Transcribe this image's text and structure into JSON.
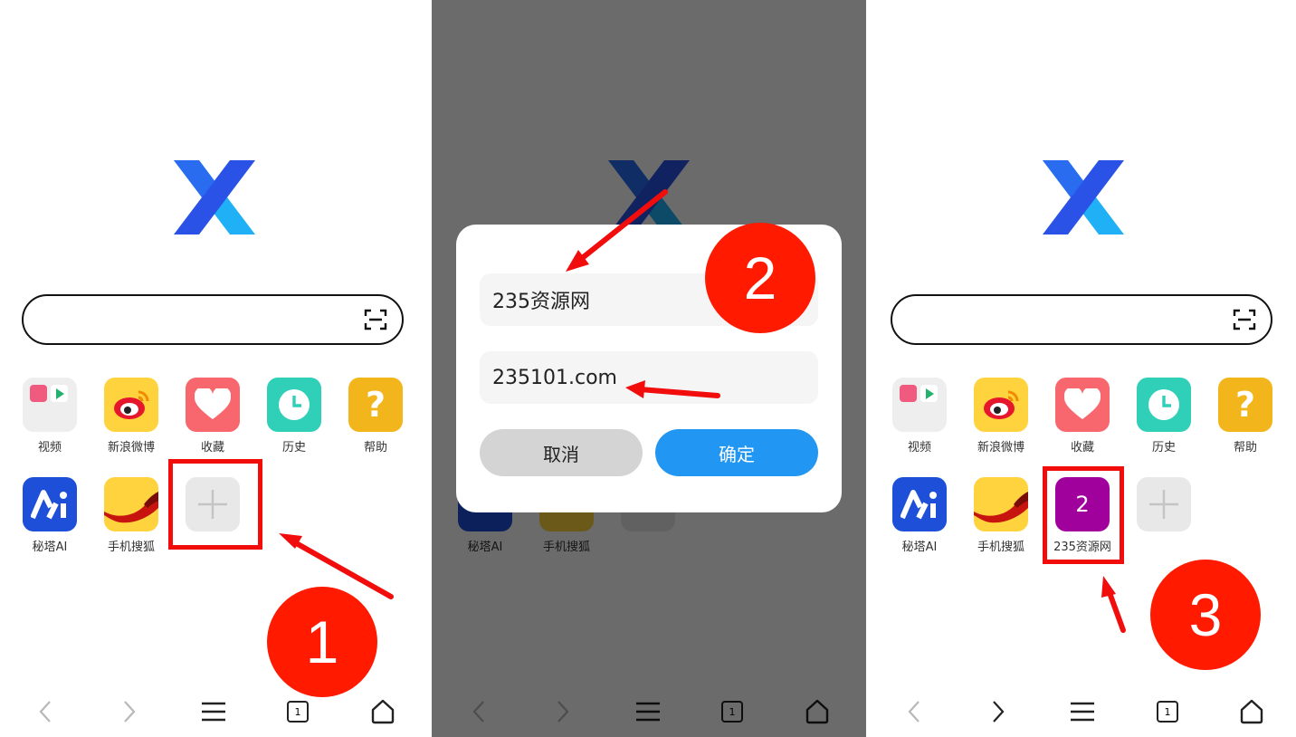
{
  "shortcuts": {
    "video": "视频",
    "weibo": "新浪微博",
    "favorites": "收藏",
    "history": "历史",
    "help": "帮助",
    "mita_ai": "秘塔AI",
    "sohu": "手机搜狐",
    "new_site": "235资源网",
    "new_site_glyph": "2"
  },
  "dialog": {
    "name_value": "235资源网",
    "url_value": "235101.com",
    "cancel_label": "取消",
    "confirm_label": "确定"
  },
  "toolbar": {
    "tab_count": "1"
  },
  "steps": {
    "step1": "1",
    "step2": "2",
    "step3": "3"
  },
  "icons": {
    "help_glyph": "?",
    "add": "plus-icon",
    "back": "chevron-left-icon",
    "forward": "chevron-right-icon",
    "menu": "menu-icon",
    "tabs": "tabs-icon",
    "home": "home-icon",
    "scan": "scan-icon"
  },
  "colors": {
    "logo_light": "#1fb0f6",
    "logo_dark": "#2a52e6",
    "video_bg": "#eeeeee",
    "weibo_bg": "#ffd33d",
    "favorites_bg": "#f7676d",
    "history_bg": "#2fcfb8",
    "help_bg": "#f3b51c",
    "mita_bg": "#1e4fd8",
    "sohu_bg": "#ffd33d",
    "new_site_bg": "#a0009c",
    "highlight": "#f20d0d",
    "confirm_bg": "#2196f3"
  }
}
